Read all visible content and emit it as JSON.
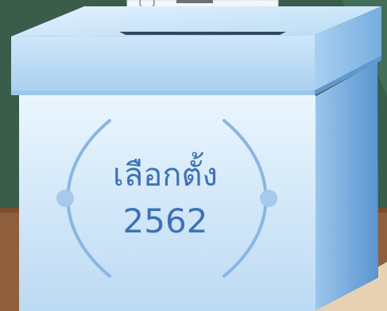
{
  "illustration": {
    "label": "เลือกตั้ง",
    "year": "2562"
  },
  "colors": {
    "wall": "#3c5e4d",
    "floor": "#8f5e3c",
    "box_front": "#d6ecfb",
    "box_side": "#5b98d1",
    "box_lid": "#bfe0f7",
    "text": "#3f72b4",
    "ornament": "#87b5e2"
  }
}
